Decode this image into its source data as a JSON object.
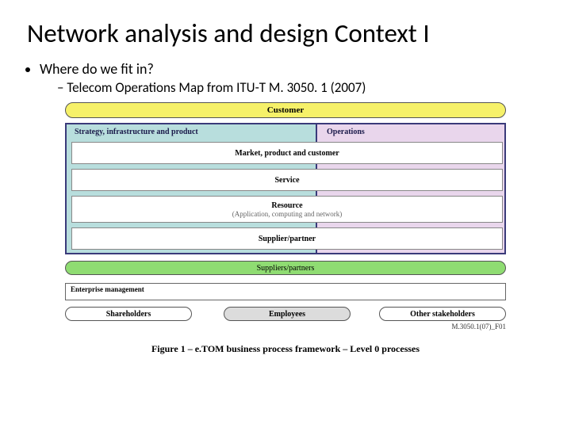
{
  "title": "Network analysis and design Context I",
  "bullet": "Where do we fit in?",
  "sub_bullet": "Telecom Operations Map from ITU-T M. 3050. 1 (2007)",
  "diagram": {
    "customer": "Customer",
    "left_col_header": "Strategy, infrastructure and product",
    "right_col_header": "Operations",
    "row1": "Market, product and customer",
    "row2": "Service",
    "row3": "Resource",
    "row3_sub": "(Application, computing and network)",
    "row4": "Supplier/partner",
    "suppliers_band": "Suppliers/partners",
    "enterprise_mgmt": "Enterprise management",
    "shareholders": "Shareholders",
    "employees": "Employees",
    "other_stakeholders": "Other stakeholders",
    "source_id": "M.3050.1(07)_F01",
    "caption": "Figure 1 – e.TOM business process framework – Level 0 processes"
  }
}
